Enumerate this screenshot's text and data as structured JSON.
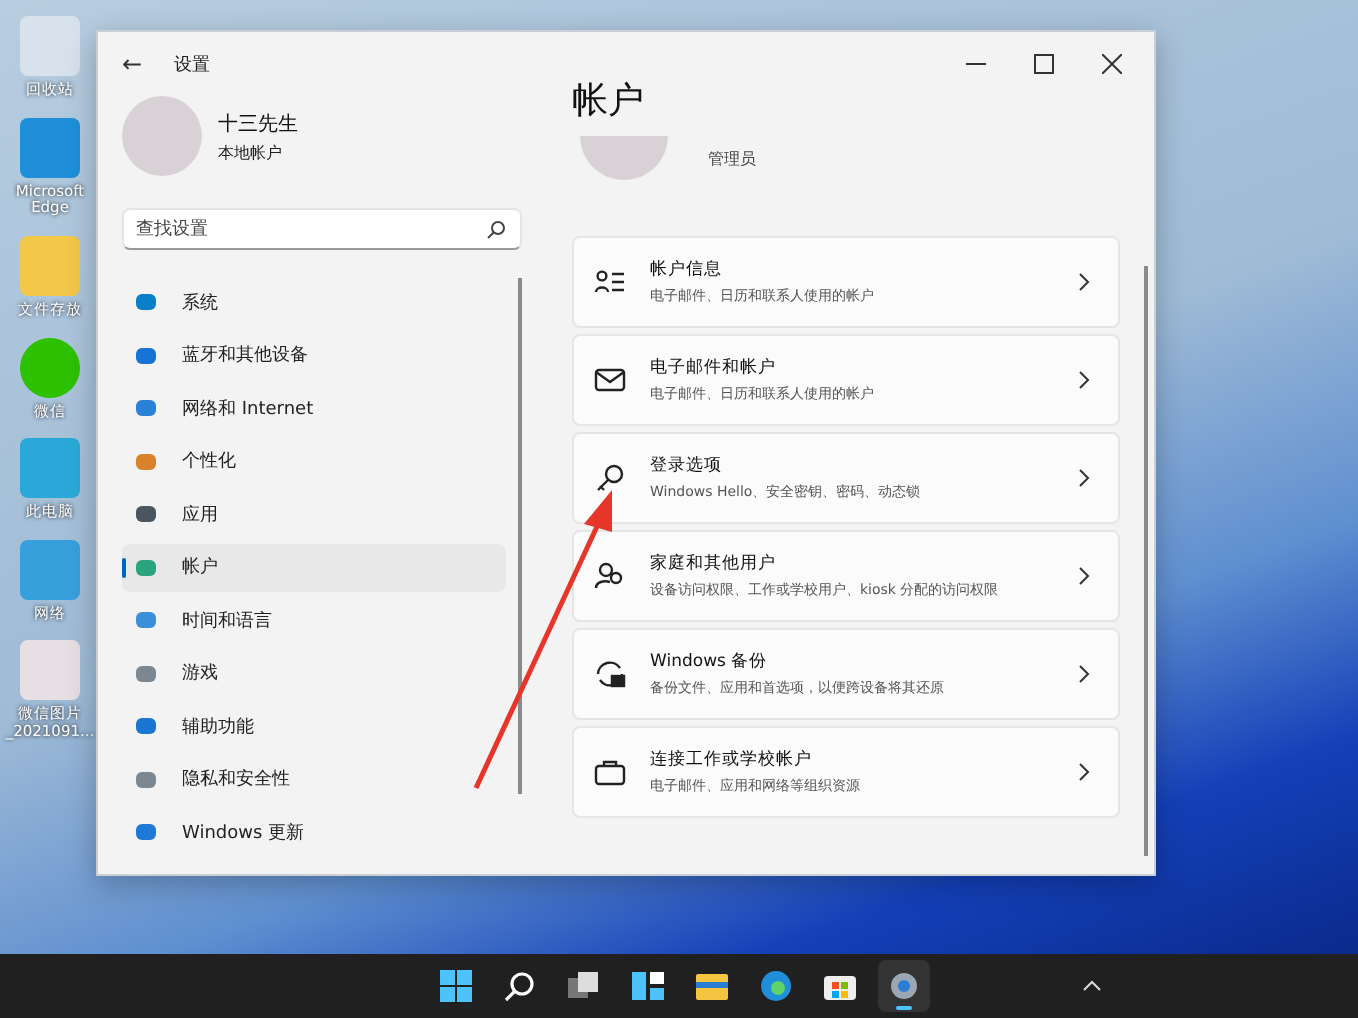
{
  "desktop_icons": [
    {
      "label": "回收站"
    },
    {
      "label": "Microsoft Edge"
    },
    {
      "label": "文件存放"
    },
    {
      "label": "微信"
    },
    {
      "label": "此电脑"
    },
    {
      "label": "网络"
    },
    {
      "label": "微信图片_2021091..."
    }
  ],
  "window": {
    "title": "设置",
    "back": "←"
  },
  "profile": {
    "name": "十三先生",
    "account_type": "本地帐户"
  },
  "search": {
    "placeholder": "查找设置"
  },
  "nav": [
    {
      "label": "系统",
      "selected": false
    },
    {
      "label": "蓝牙和其他设备",
      "selected": false
    },
    {
      "label": "网络和 Internet",
      "selected": false
    },
    {
      "label": "个性化",
      "selected": false
    },
    {
      "label": "应用",
      "selected": false
    },
    {
      "label": "帐户",
      "selected": true
    },
    {
      "label": "时间和语言",
      "selected": false
    },
    {
      "label": "游戏",
      "selected": false
    },
    {
      "label": "辅助功能",
      "selected": false
    },
    {
      "label": "隐私和安全性",
      "selected": false
    },
    {
      "label": "Windows 更新",
      "selected": false
    }
  ],
  "page": {
    "title": "帐户",
    "role": "管理员"
  },
  "cards": [
    {
      "title": "帐户信息",
      "subtitle": "电子邮件、日历和联系人使用的帐户"
    },
    {
      "title": "电子邮件和帐户",
      "subtitle": "电子邮件、日历和联系人使用的帐户"
    },
    {
      "title": "登录选项",
      "subtitle": "Windows Hello、安全密钥、密码、动态锁"
    },
    {
      "title": "家庭和其他用户",
      "subtitle": "设备访问权限、工作或学校用户、kiosk 分配的访问权限"
    },
    {
      "title": "Windows 备份",
      "subtitle": "备份文件、应用和首选项，以便跨设备将其还原"
    },
    {
      "title": "连接工作或学校帐户",
      "subtitle": "电子邮件、应用和网络等组织资源"
    }
  ],
  "taskbar": [
    {
      "kind": "start",
      "active": false
    },
    {
      "kind": "search",
      "active": false
    },
    {
      "kind": "taskview",
      "active": false
    },
    {
      "kind": "widgets",
      "active": false
    },
    {
      "kind": "explorer",
      "active": false
    },
    {
      "kind": "edge",
      "active": false
    },
    {
      "kind": "store",
      "active": false
    },
    {
      "kind": "settings",
      "active": true
    }
  ]
}
